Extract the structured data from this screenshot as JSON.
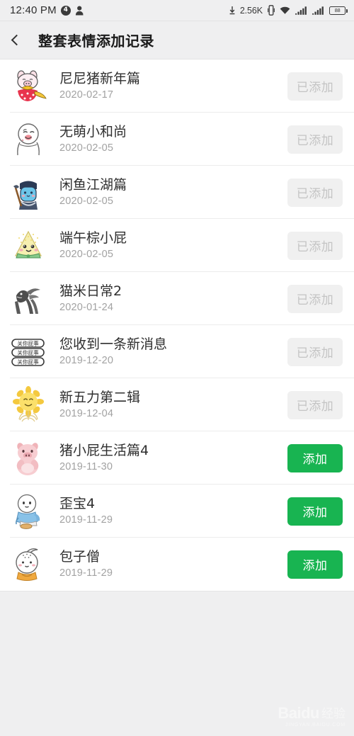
{
  "statusbar": {
    "time": "12:40 PM",
    "notif_badge": "4",
    "person_icon": "person-icon",
    "data_rate": "2.56K",
    "download_arrow": "download-arrow-icon",
    "vibrate_icon": "vibrate-icon",
    "wifi_icon": "wifi-icon",
    "signal1_icon": "signal-bars-icon",
    "signal2_icon": "signal-bars-icon",
    "battery_level": "88"
  },
  "header": {
    "back_icon": "back-chevron-icon",
    "title": "整套表情添加记录"
  },
  "list": {
    "items": [
      {
        "thumb": "pig-new-year-sticker-icon",
        "title": "尼尼猪新年篇",
        "date": "2020-02-17",
        "action_label": "已添加",
        "action_state": "added"
      },
      {
        "thumb": "little-monk-sticker-icon",
        "title": "无萌小和尚",
        "date": "2020-02-05",
        "action_label": "已添加",
        "action_state": "added"
      },
      {
        "thumb": "xianyu-fish-sticker-icon",
        "title": "闲鱼江湖篇",
        "date": "2020-02-05",
        "action_label": "已添加",
        "action_state": "added"
      },
      {
        "thumb": "zongzi-sticker-icon",
        "title": "端午棕小屁",
        "date": "2020-02-05",
        "action_label": "已添加",
        "action_state": "added"
      },
      {
        "thumb": "cat-daily-sticker-icon",
        "title": "猫米日常2",
        "date": "2020-01-24",
        "action_label": "已添加",
        "action_state": "added"
      },
      {
        "thumb": "message-pills-sticker-icon",
        "title": "您收到一条新消息",
        "date": "2019-12-20",
        "action_label": "已添加",
        "action_state": "added"
      },
      {
        "thumb": "sunflower-sticker-icon",
        "title": "新五力第二辑",
        "date": "2019-12-04",
        "action_label": "已添加",
        "action_state": "added"
      },
      {
        "thumb": "pig-life-sticker-icon",
        "title": "猪小屁生活篇4",
        "date": "2019-11-30",
        "action_label": "添加",
        "action_state": "add"
      },
      {
        "thumb": "waibao-sticker-icon",
        "title": "歪宝4",
        "date": "2019-11-29",
        "action_label": "添加",
        "action_state": "add"
      },
      {
        "thumb": "baozi-monk-sticker-icon",
        "title": "包子僧",
        "date": "2019-11-29",
        "action_label": "添加",
        "action_state": "add"
      }
    ]
  },
  "watermark": {
    "brand": "Baidu",
    "brand_cn": "经验",
    "subtitle": "JINGYAN.BAIDU.COM"
  },
  "colors": {
    "accent_green": "#18b451",
    "disabled_gray": "#f0f0f0",
    "page_bg": "#efeff0"
  }
}
